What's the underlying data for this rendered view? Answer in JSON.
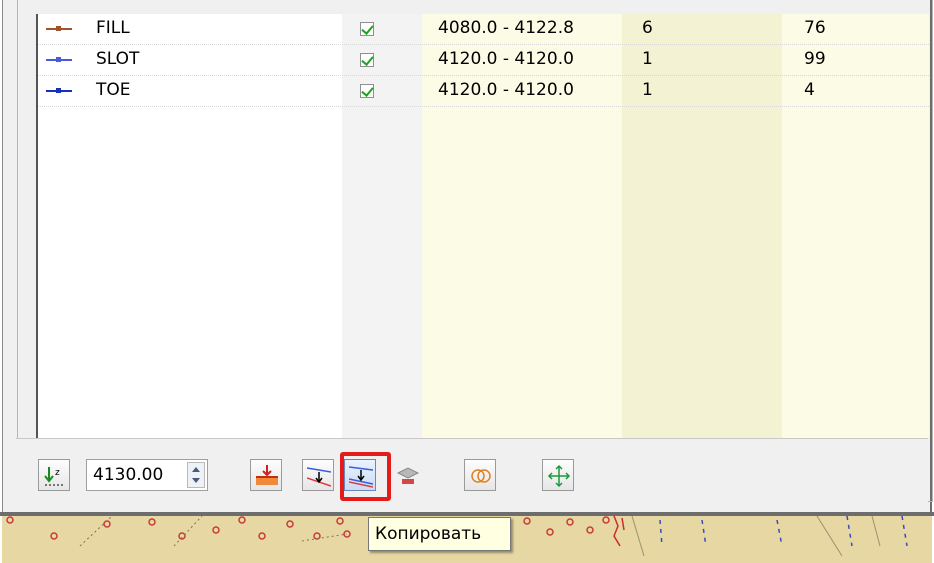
{
  "layers": [
    {
      "name": "FILL",
      "checked": true,
      "range": "4080.0 - 4122.8",
      "count": "6",
      "id": "76",
      "color": "#a0522d"
    },
    {
      "name": "SLOT",
      "checked": true,
      "range": "4120.0 - 4120.0",
      "count": "1",
      "id": "99",
      "color": "#4a5ad8"
    },
    {
      "name": "TOE",
      "checked": true,
      "range": "4120.0 - 4120.0",
      "count": "1",
      "id": "4",
      "color": "#1a2fb8"
    }
  ],
  "toolbar": {
    "z_value": "4130.00",
    "sort_z_icon": "sort-z-icon",
    "tooltip": "Копировать"
  },
  "colors": {
    "highlight": "#e41b1b",
    "map_background": "#e6d7a3",
    "tooltip_background": "#ffffe1"
  }
}
